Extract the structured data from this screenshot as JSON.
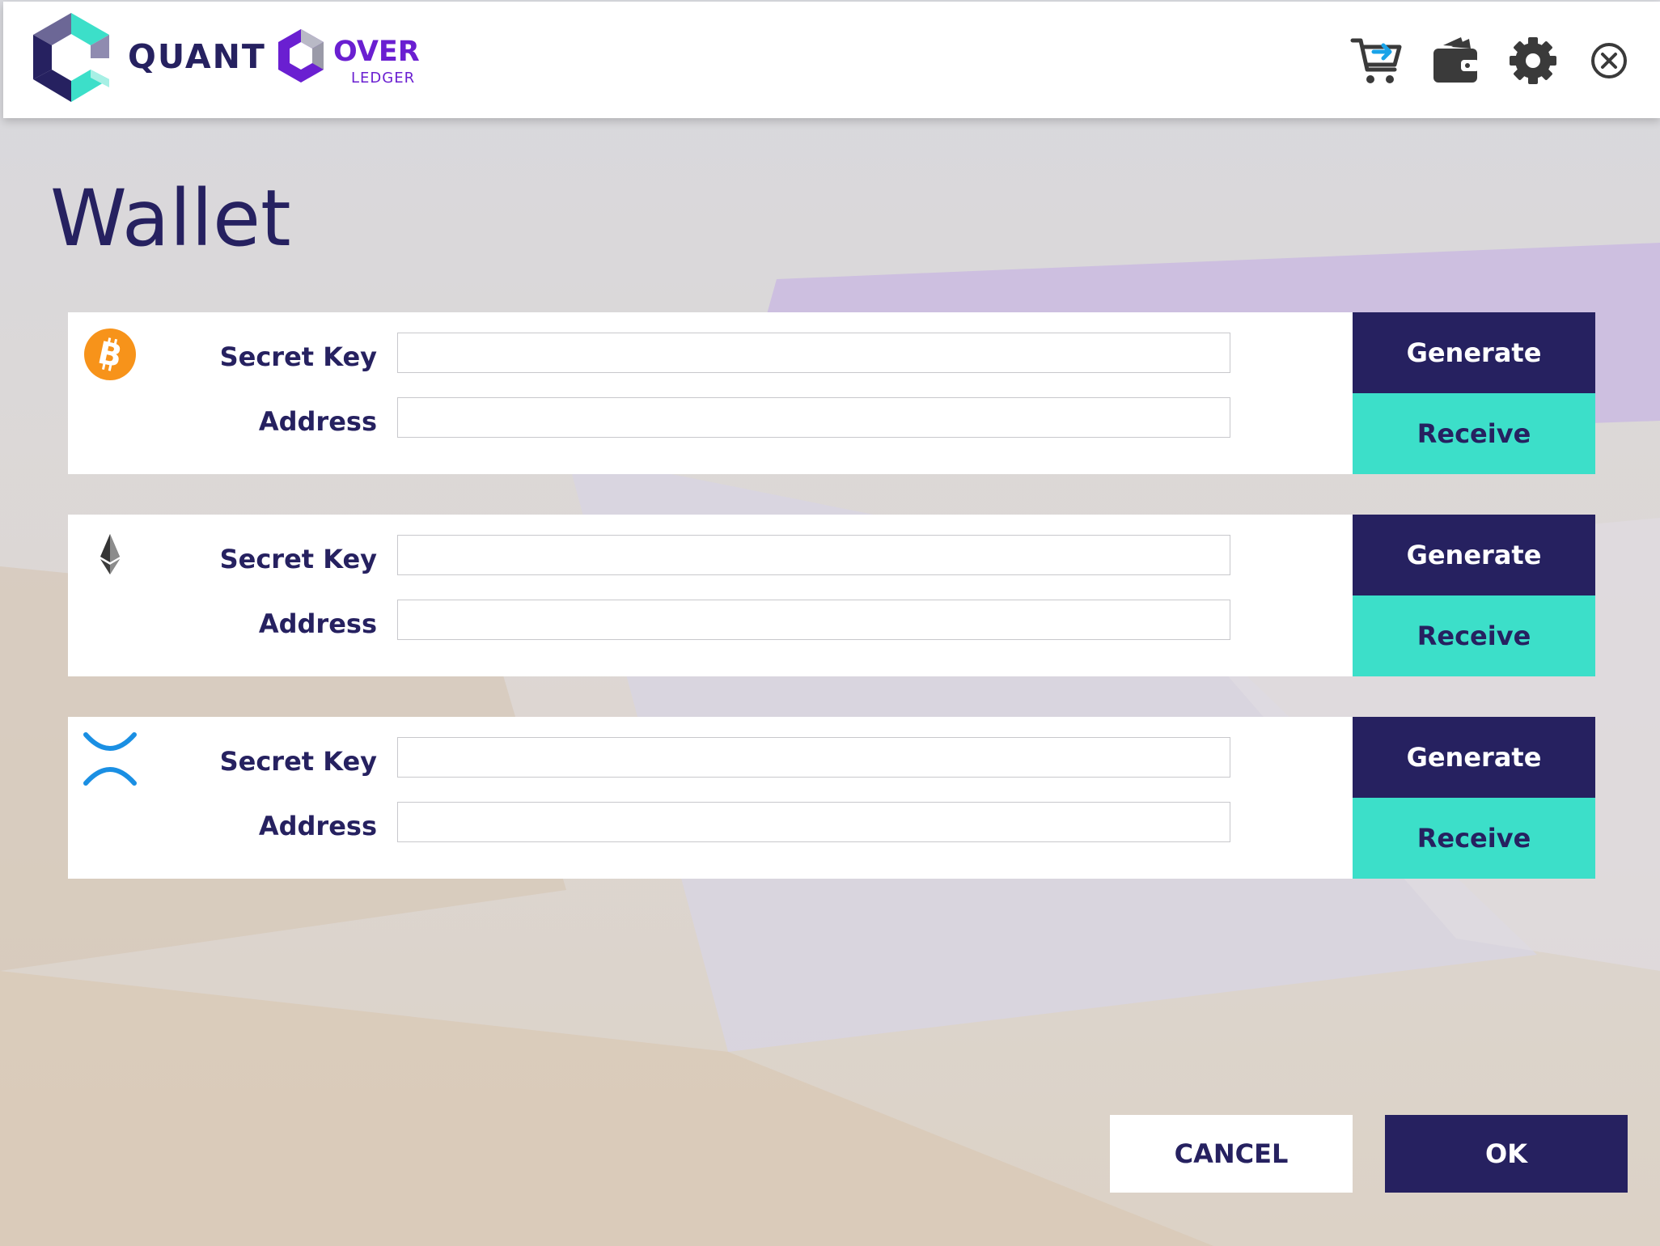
{
  "header": {
    "brand": "QUANT",
    "product_over": "OVER",
    "product_ledger": "LEDGER",
    "icons": [
      "cart-transfer-icon",
      "wallet-icon",
      "gear-icon",
      "close-circle-icon"
    ]
  },
  "page": {
    "title": "Wallet"
  },
  "wallets": [
    {
      "coin": "bitcoin",
      "icon": "bitcoin-icon",
      "secret_key_label": "Secret Key",
      "secret_key_value": "",
      "address_label": "Address",
      "address_value": "",
      "generate_label": "Generate",
      "receive_label": "Receive"
    },
    {
      "coin": "ethereum",
      "icon": "ethereum-icon",
      "secret_key_label": "Secret Key",
      "secret_key_value": "",
      "address_label": "Address",
      "address_value": "",
      "generate_label": "Generate",
      "receive_label": "Receive"
    },
    {
      "coin": "ripple",
      "icon": "ripple-icon",
      "secret_key_label": "Secret Key",
      "secret_key_value": "",
      "address_label": "Address",
      "address_value": "",
      "generate_label": "Generate",
      "receive_label": "Receive"
    }
  ],
  "footer": {
    "cancel_label": "CANCEL",
    "ok_label": "OK"
  },
  "colors": {
    "navy": "#262160",
    "teal": "#3cdfc9",
    "purple": "#6a1fd1",
    "bitcoin_orange": "#f7931a",
    "ripple_blue": "#1a8fe3"
  }
}
